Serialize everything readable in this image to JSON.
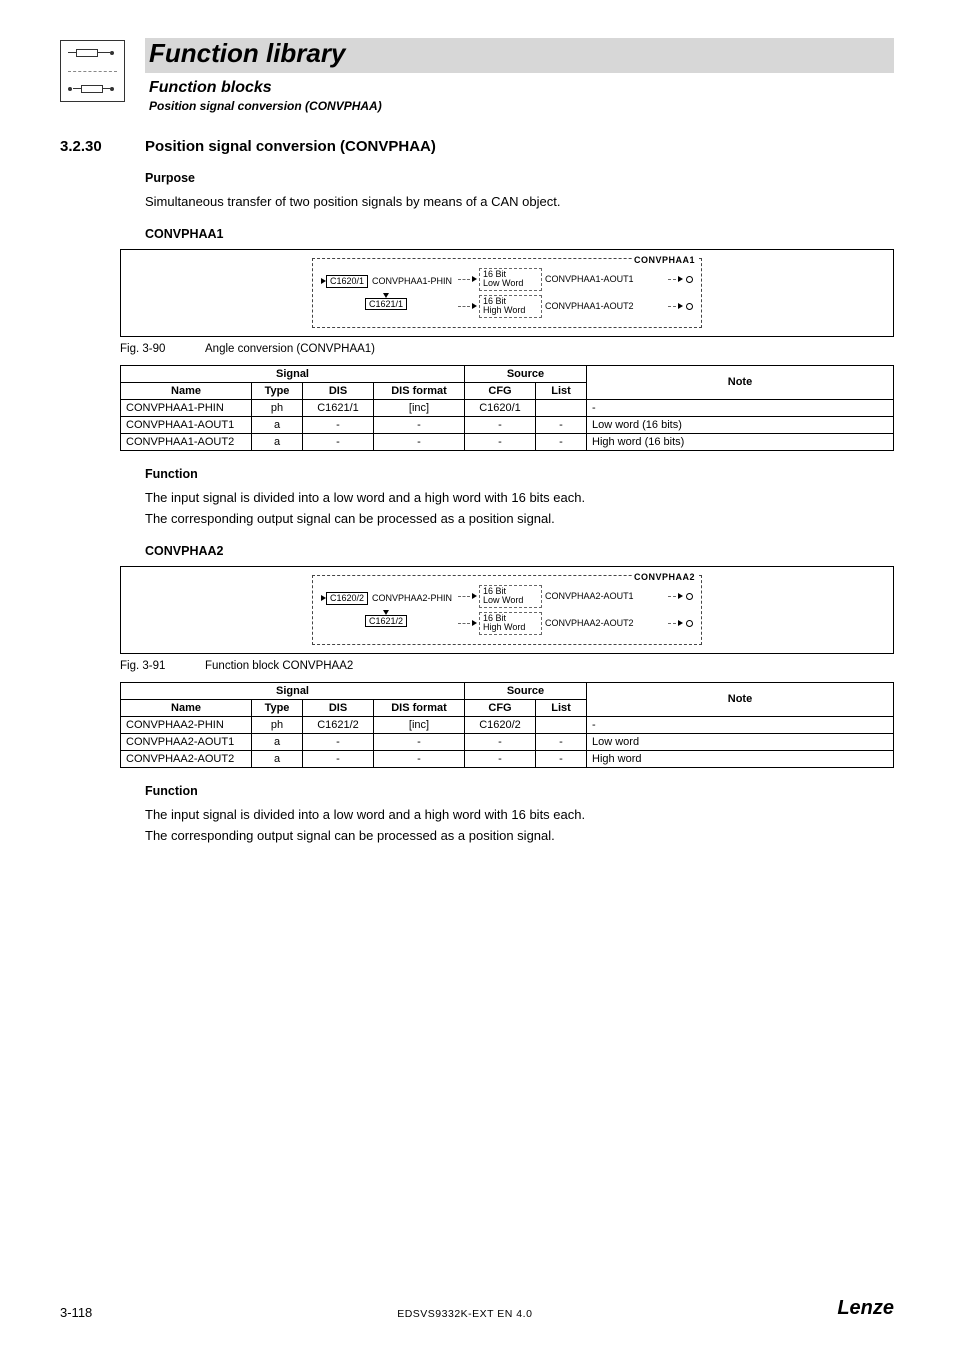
{
  "header": {
    "title": "Function library",
    "subtitle": "Function blocks",
    "subtitle2": "Position signal conversion (CONVPHAA)"
  },
  "section": {
    "number": "3.2.30",
    "title": "Position signal conversion (CONVPHAA)"
  },
  "purpose": {
    "heading": "Purpose",
    "text": "Simultaneous transfer of two position signals by means of a CAN object."
  },
  "blocks": [
    {
      "heading": "CONVPHAA1",
      "diagram": {
        "title": "CONVPHAA1",
        "input_label": "CONVPHAA1-PHIN",
        "input_code": "C1620/1",
        "dis_code": "C1621/1",
        "outputs": [
          {
            "box_line1": "16 Bit",
            "box_line2": "Low Word",
            "label": "CONVPHAA1-AOUT1"
          },
          {
            "box_line1": "16 Bit",
            "box_line2": "High Word",
            "label": "CONVPHAA1-AOUT2"
          }
        ]
      },
      "caption": {
        "ref": "Fig. 3-90",
        "text": "Angle conversion (CONVPHAA1)"
      },
      "table": {
        "headers": {
          "signal": "Signal",
          "source": "Source",
          "note": "Note",
          "name": "Name",
          "type": "Type",
          "dis": "DIS",
          "disf": "DIS format",
          "cfg": "CFG",
          "list": "List"
        },
        "rows": [
          {
            "name": "CONVPHAA1-PHIN",
            "type": "ph",
            "dis": "C1621/1",
            "disf": "[inc]",
            "cfg": "C1620/1",
            "list": "",
            "note": "-"
          },
          {
            "name": "CONVPHAA1-AOUT1",
            "type": "a",
            "dis": "-",
            "disf": "-",
            "cfg": "-",
            "list": "-",
            "note": "Low word (16 bits)"
          },
          {
            "name": "CONVPHAA1-AOUT2",
            "type": "a",
            "dis": "-",
            "disf": "-",
            "cfg": "-",
            "list": "-",
            "note": "High word (16 bits)"
          }
        ]
      },
      "function": {
        "heading": "Function",
        "p1": "The input signal is divided into a low word and a high word with 16 bits each.",
        "p2": "The corresponding output signal can be processed as a position signal."
      }
    },
    {
      "heading": "CONVPHAA2",
      "diagram": {
        "title": "CONVPHAA2",
        "input_label": "CONVPHAA2-PHIN",
        "input_code": "C1620/2",
        "dis_code": "C1621/2",
        "outputs": [
          {
            "box_line1": "16 Bit",
            "box_line2": "Low Word",
            "label": "CONVPHAA2-AOUT1"
          },
          {
            "box_line1": "16 Bit",
            "box_line2": "High Word",
            "label": "CONVPHAA2-AOUT2"
          }
        ]
      },
      "caption": {
        "ref": "Fig. 3-91",
        "text": "Function block CONVPHAA2"
      },
      "table": {
        "headers": {
          "signal": "Signal",
          "source": "Source",
          "note": "Note",
          "name": "Name",
          "type": "Type",
          "dis": "DIS",
          "disf": "DIS format",
          "cfg": "CFG",
          "list": "List"
        },
        "rows": [
          {
            "name": "CONVPHAA2-PHIN",
            "type": "ph",
            "dis": "C1621/2",
            "disf": "[inc]",
            "cfg": "C1620/2",
            "list": "",
            "note": "-"
          },
          {
            "name": "CONVPHAA2-AOUT1",
            "type": "a",
            "dis": "-",
            "disf": "-",
            "cfg": "-",
            "list": "-",
            "note": "Low word"
          },
          {
            "name": "CONVPHAA2-AOUT2",
            "type": "a",
            "dis": "-",
            "disf": "-",
            "cfg": "-",
            "list": "-",
            "note": "High word"
          }
        ]
      },
      "function": {
        "heading": "Function",
        "p1": "The input signal is divided into a low word and a high word with 16 bits each.",
        "p2": "The corresponding output signal can be processed as a position signal."
      }
    }
  ],
  "footer": {
    "page": "3-118",
    "doc": "EDSVS9332K-EXT EN 4.0",
    "brand": "Lenze"
  }
}
